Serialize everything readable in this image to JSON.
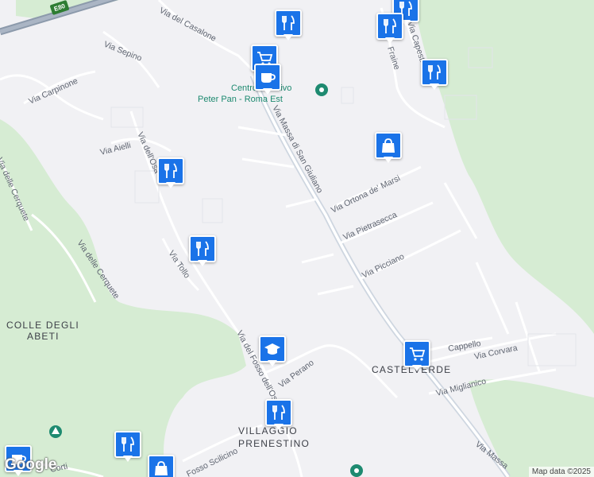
{
  "map": {
    "colors": {
      "land": "#f1f1f4",
      "park": "#d6ecd3",
      "road": "#ffffff",
      "main_road": "#ced6e0",
      "pin": "#1a73e8",
      "highway": "#8c9aab"
    },
    "highway_shield": "E80",
    "streets": {
      "via_del_casalone": "Via del Casalone",
      "via_sepino": "Via Sepino",
      "via_carpinone": "Via Carpinone",
      "via_aielli": "Via Aielli",
      "via_dell_osa": "Via dell'Osa",
      "via_delle_cerquete_top": "Via delle Cerquete",
      "via_delle_cerquete": "Via delle Cerquete",
      "via_tollo": "Via Tollo",
      "via_massa_di_san_giuliano": "Via Massa di San Giuliano",
      "via_ortona_de_marsi": "Via Ortona de' Marsi",
      "via_pietrasecca": "Via Pietrasecca",
      "via_picciano": "Via Picciano",
      "via_fosso_dell_osa": "Via del Fosso dell'Osa",
      "via_perano": "Via Perano",
      "via_fraine": "Fraine",
      "via_capestrano": "Via Capestrano",
      "via_cappello": "Cappello",
      "via_corvara": "Via Corvara",
      "via_miglianico": "Via Miglianico",
      "via_massa_bottom": "Via Massa",
      "via_fosso_scilicino": "Fosso Scilicino",
      "via_corti": "Corti"
    },
    "areas": {
      "colle_line1": "COLLE DEGLI",
      "colle_line2": "ABETI",
      "castelverde": "CASTELVERDE",
      "villaggio_line1": "VILLAGGIO",
      "villaggio_line2": "PRENESTINO"
    },
    "poi": {
      "peter_pan_line1": "Centro Sportivo",
      "peter_pan_line2": "Peter Pan - Roma Est"
    },
    "markers": [
      {
        "icon": "restaurant-icon",
        "interactable": true
      },
      {
        "icon": "restaurant-icon",
        "interactable": true
      },
      {
        "icon": "restaurant-icon",
        "interactable": true
      },
      {
        "icon": "restaurant-icon",
        "interactable": true
      },
      {
        "icon": "shopping-cart-icon",
        "interactable": true
      },
      {
        "icon": "cafe-icon",
        "interactable": true
      },
      {
        "icon": "shopping-bag-icon",
        "interactable": true
      },
      {
        "icon": "restaurant-icon",
        "interactable": true
      },
      {
        "icon": "restaurant-icon",
        "interactable": true
      },
      {
        "icon": "school-icon",
        "interactable": true
      },
      {
        "icon": "shopping-cart-icon",
        "interactable": true
      },
      {
        "icon": "restaurant-icon",
        "interactable": true
      },
      {
        "icon": "restaurant-icon",
        "interactable": true
      },
      {
        "icon": "cafe-icon",
        "interactable": true
      },
      {
        "icon": "shopping-bag-icon",
        "interactable": true
      }
    ],
    "google_logo": "Google",
    "attribution": "Map data ©2025"
  }
}
